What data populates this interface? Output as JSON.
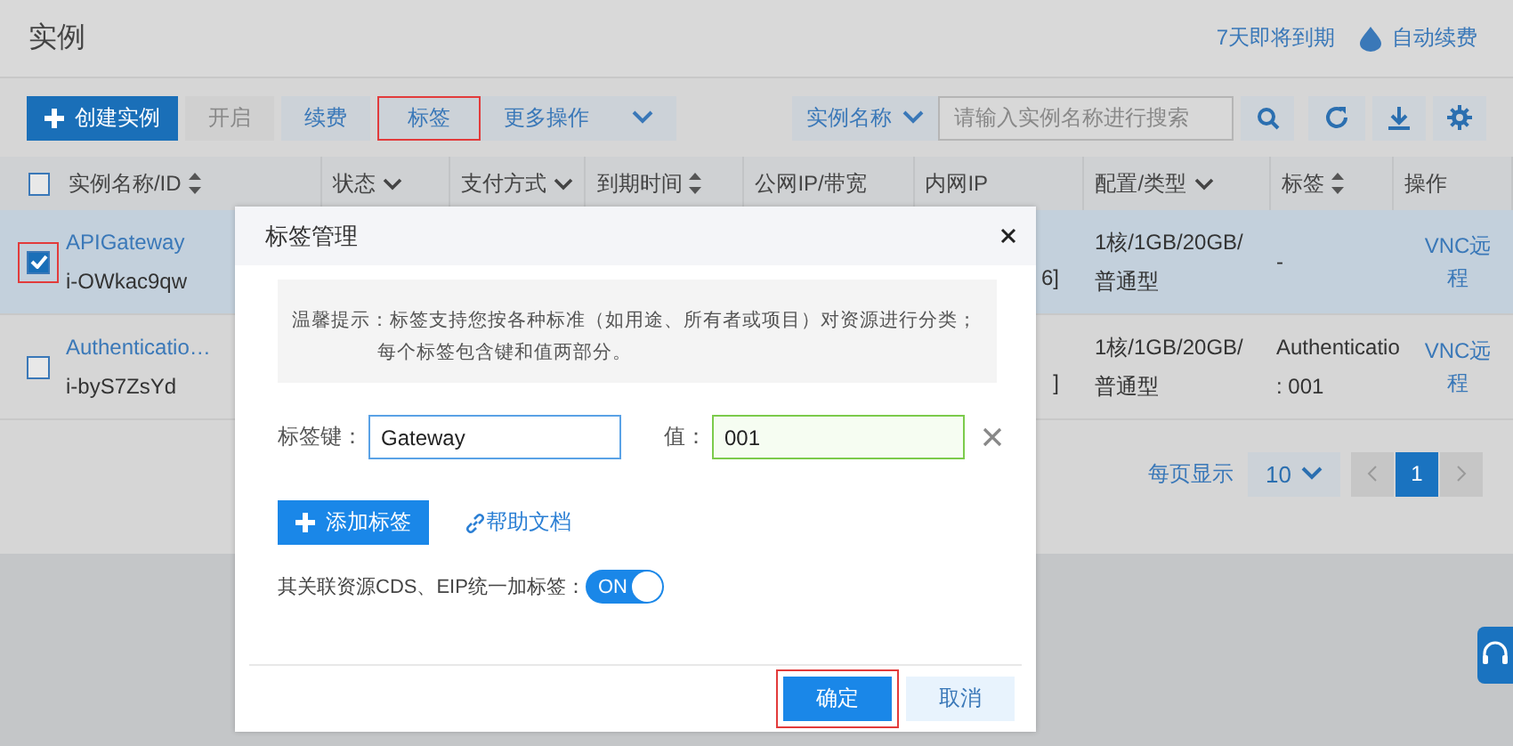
{
  "page": {
    "title": "实例",
    "expiring_link": "7天即将到期",
    "auto_renew": "自动续费"
  },
  "toolbar": {
    "buttons": [
      {
        "label": "创建实例",
        "kind": "primary",
        "highlighted": false
      },
      {
        "label": "开启",
        "kind": "disabled",
        "highlighted": false
      },
      {
        "label": "续费",
        "kind": "default",
        "highlighted": false
      },
      {
        "label": "标签",
        "kind": "default",
        "highlighted": true
      },
      {
        "label": "更多操作",
        "kind": "dropdown",
        "highlighted": false
      }
    ],
    "search_filter": "实例名称",
    "search": {
      "placeholder": "请输入实例名称进行搜索"
    }
  },
  "table": {
    "select_all_checked": false,
    "columns": [
      {
        "label": "实例名称/ID",
        "kind": "sort"
      },
      {
        "label": "状态",
        "kind": "filter"
      },
      {
        "label": "支付方式",
        "kind": "filter"
      },
      {
        "label": "到期时间",
        "kind": "sort"
      },
      {
        "label": "公网IP/带宽",
        "kind": "none"
      },
      {
        "label": "内网IP",
        "kind": "none"
      },
      {
        "label": "配置/类型",
        "kind": "filter"
      },
      {
        "label": "标签",
        "kind": "sort"
      },
      {
        "label": "操作",
        "kind": "none"
      }
    ],
    "rows": [
      {
        "checked": true,
        "selected": true,
        "highlighted": true,
        "name": "APIGateway",
        "id": "i-OWkac9qw",
        "private_ip": "6]",
        "config": "1核/1GB/20GB/\n普通型",
        "tag": "-",
        "action": "VNC远程"
      },
      {
        "checked": false,
        "selected": false,
        "highlighted": false,
        "name": "Authenticatio…",
        "id": "i-byS7ZsYd",
        "private_ip": "]",
        "config": "1核/1GB/20GB/\n普通型",
        "tag": "Authenticatio\n: 001",
        "action": "VNC远程"
      }
    ]
  },
  "pagination": {
    "page_size_label": "每页显示",
    "page_size": "10",
    "pages": [
      {
        "label": "1",
        "selected": true
      }
    ]
  },
  "dialog": {
    "title": "标签管理",
    "notice": [
      "温馨提示：标签支持您按各种标准（如用途、所有者或项目）对资源进行分类；",
      "每个标签包含键和值两部分。"
    ],
    "key_label": "标签键：",
    "value_label": "值：",
    "tags": [
      {
        "key": "Gateway",
        "key_focused": true,
        "value": "001",
        "value_valid": true
      }
    ],
    "add_button": "添加标签",
    "help_link": "帮助文档",
    "sync_label": "其关联资源CDS、EIP统一加标签：",
    "sync_toggle": {
      "on": true,
      "label": "ON"
    },
    "buttons": [
      {
        "label": "确定",
        "kind": "primary",
        "highlighted": true
      },
      {
        "label": "取消",
        "kind": "secondary",
        "highlighted": false
      }
    ]
  }
}
